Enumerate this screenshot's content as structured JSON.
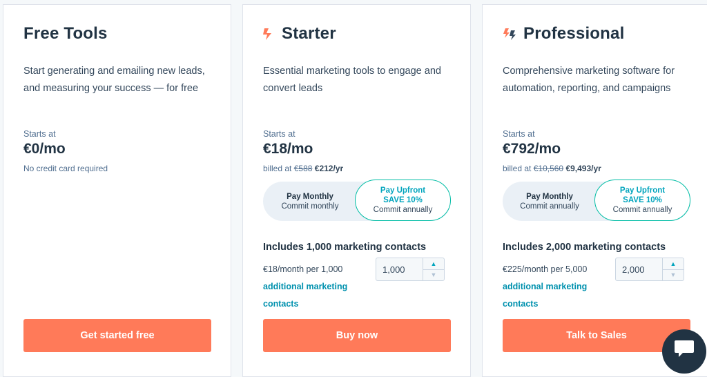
{
  "free": {
    "title": "Free Tools",
    "description": "Start generating and emailing new leads, and measuring your success — for free",
    "starts_at": "Starts at",
    "price": "€0/mo",
    "note": "No credit card required",
    "cta": "Get started free"
  },
  "starter": {
    "title": "Starter",
    "icon": "sprocket-icon",
    "description": "Essential marketing tools to engage and convert leads",
    "starts_at": "Starts at",
    "price": "€18/mo",
    "billed_prefix": "billed at",
    "billed_old": "€588",
    "billed_new": "€212/yr",
    "toggle": {
      "monthly_label": "Pay Monthly",
      "monthly_sub": "Commit monthly",
      "upfront_label": "Pay Upfront",
      "upfront_save": "SAVE 10%",
      "upfront_sub": "Commit annually"
    },
    "contacts_title": "Includes 1,000 marketing contacts",
    "per_text": "€18/month per 1,000",
    "per_link": "additional marketing contacts",
    "stepper_value": "1,000",
    "cta": "Buy now"
  },
  "pro": {
    "title": "Professional",
    "icon": "double-sprocket-icon",
    "description": "Comprehensive marketing software for automation, reporting, and campaigns",
    "starts_at": "Starts at",
    "price": "€792/mo",
    "billed_prefix": "billed at",
    "billed_old": "€10,560",
    "billed_new": "€9,493/yr",
    "toggle": {
      "monthly_label": "Pay Monthly",
      "monthly_sub": "Commit annually",
      "upfront_label": "Pay Upfront",
      "upfront_save": "SAVE 10%",
      "upfront_sub": "Commit annually"
    },
    "contacts_title": "Includes 2,000 marketing contacts",
    "per_text": "€225/month per 5,000",
    "per_link": "additional marketing contacts",
    "stepper_value": "2,000",
    "cta": "Talk to Sales"
  },
  "chat": {
    "icon": "chat-bubble-icon"
  },
  "colors": {
    "accent": "#ff7a59",
    "teal": "#00bda5",
    "link": "#0091ae",
    "heading": "#213343"
  }
}
